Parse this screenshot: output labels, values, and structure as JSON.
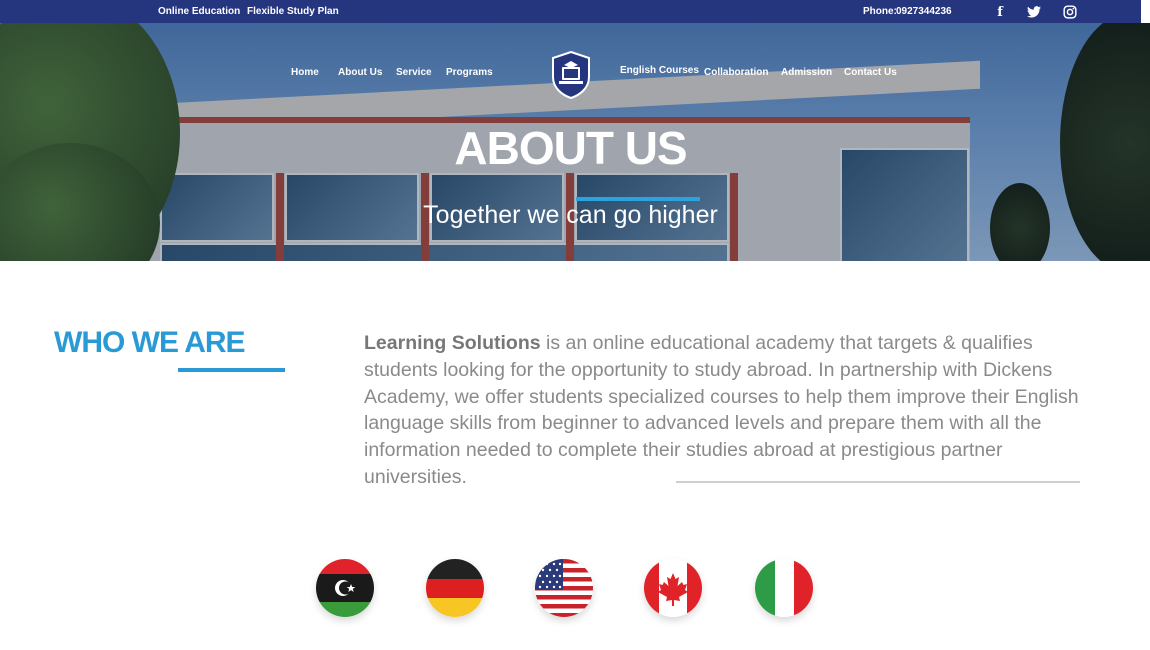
{
  "topbar": {
    "left_items": [
      "Online Education",
      "Flexible Study Plan"
    ],
    "phone_label": "Phone:",
    "phone_number": "0927344236",
    "social_icons": [
      "facebook-icon",
      "twitter-icon",
      "instagram-icon"
    ]
  },
  "nav": {
    "left": [
      "Home",
      "About Us",
      "Service",
      "Programs"
    ],
    "right": [
      "English Courses",
      "Collaboration",
      "Admission",
      "Contact Us"
    ]
  },
  "hero": {
    "title": "ABOUT US",
    "subtitle": "Together we can go higher"
  },
  "who": {
    "heading": "WHO WE ARE",
    "brand": "Learning Solutions",
    "text": " is an online educational academy that targets & qualifies students looking for the opportunity to study abroad. In partnership with Dickens Academy, we offer students specialized courses to help them improve their English language skills from beginner to advanced levels and prepare them with all the information needed to complete their studies abroad at prestigious partner universities."
  },
  "flags": [
    "libya-flag",
    "germany-flag",
    "usa-flag",
    "canada-flag",
    "italy-flag"
  ],
  "colors": {
    "topbar": "#25367f",
    "accent": "#2a9ad6",
    "text": "#8a8a8a"
  }
}
